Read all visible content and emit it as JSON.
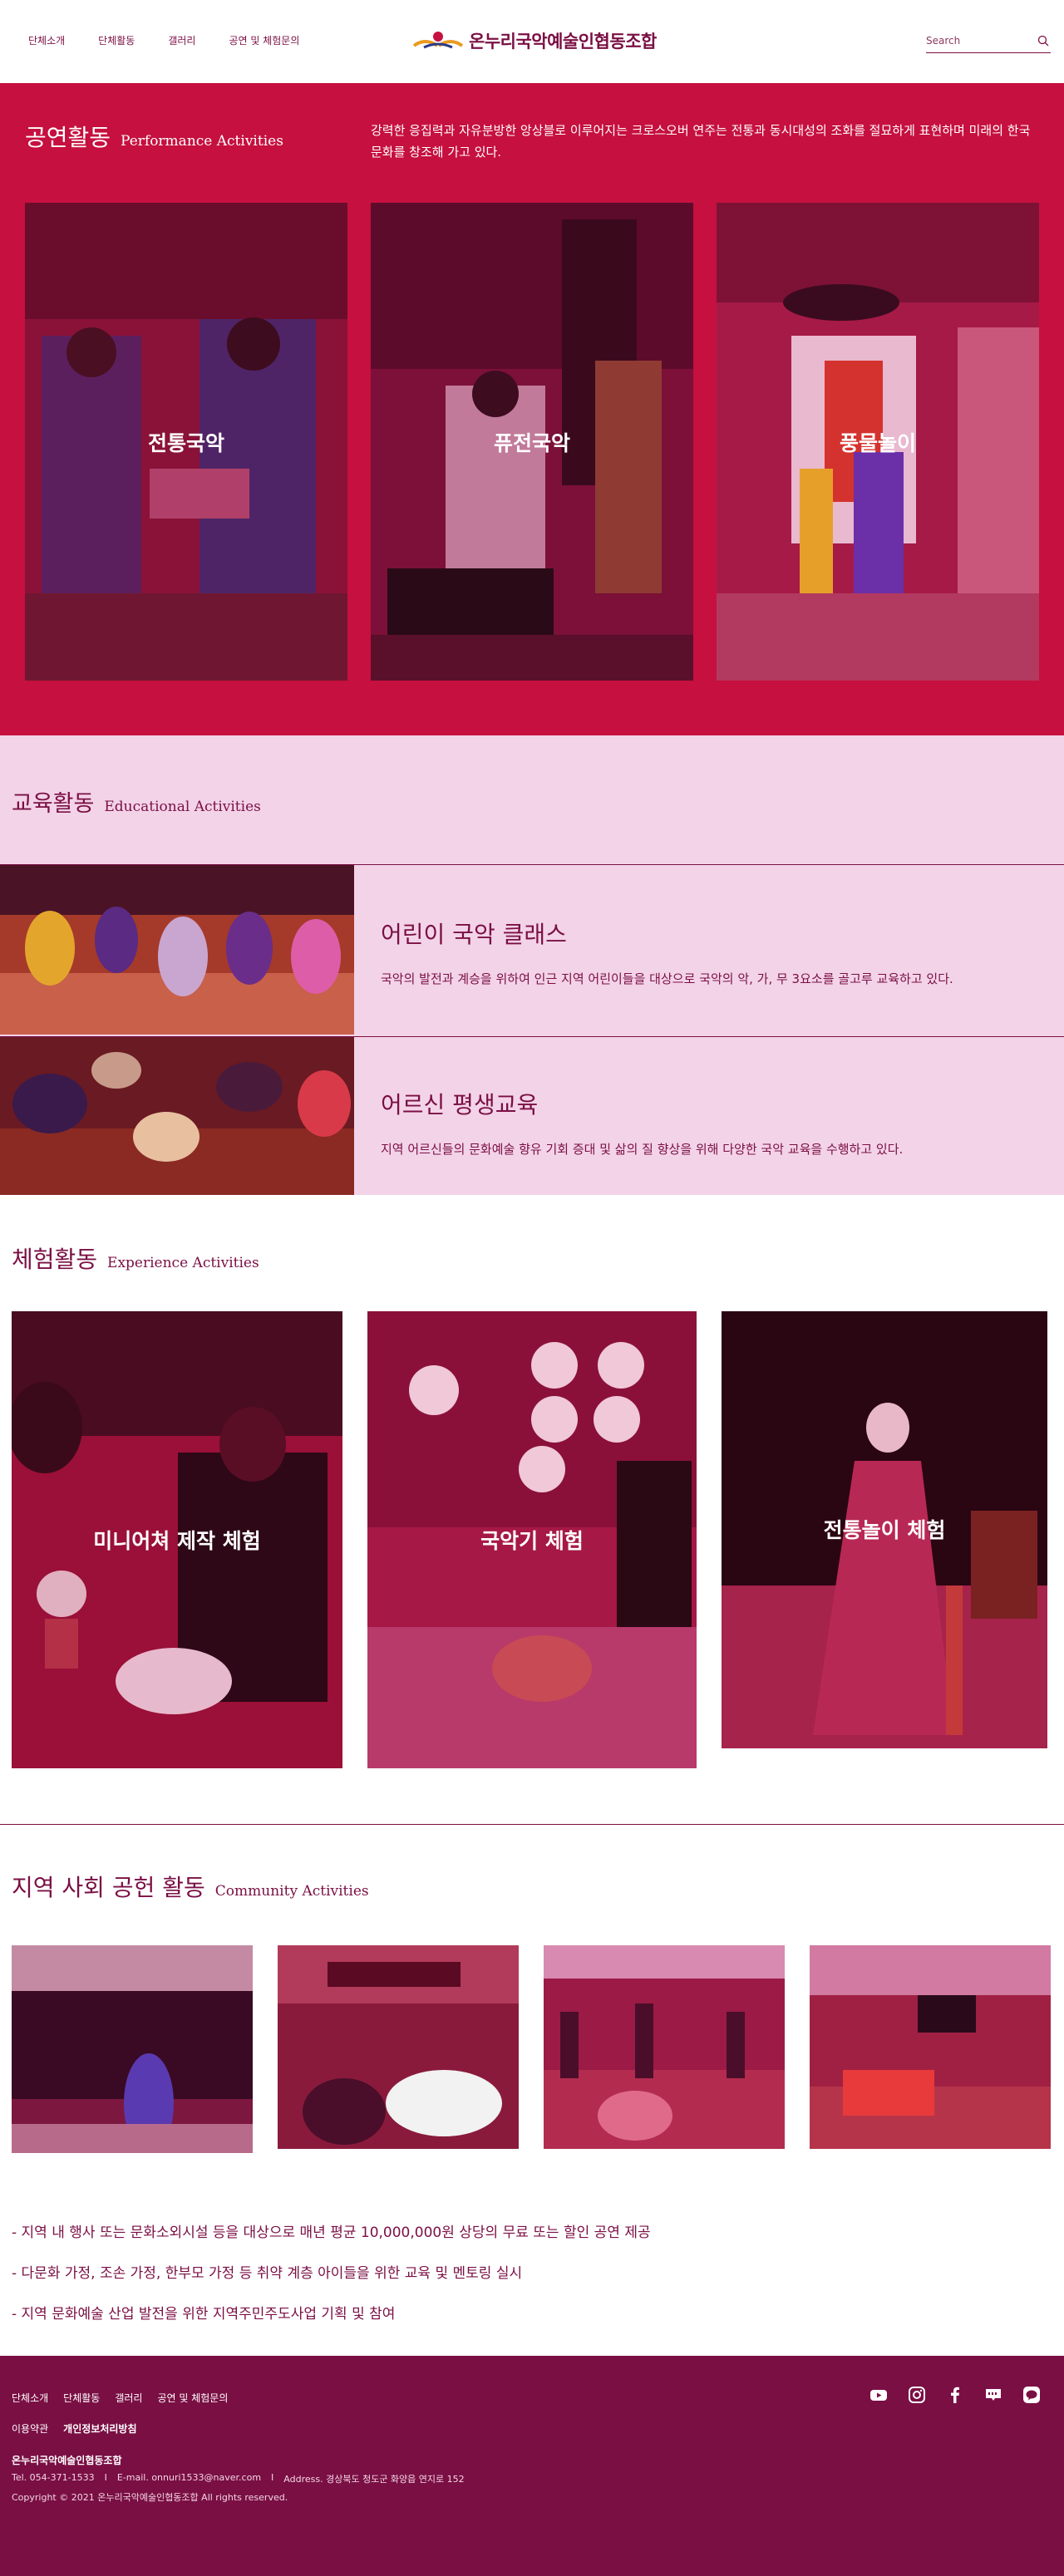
{
  "header": {
    "nav": [
      "단체소개",
      "단체활동",
      "갤러리",
      "공연 및 체험문의"
    ],
    "logo_text": "온누리국악예술인협동조합",
    "search_placeholder": "Search"
  },
  "performance": {
    "title_ko": "공연활동",
    "title_en": "Performance Activities",
    "description": "강력한 응집력과 자유분방한 앙상블로 이루어지는 크로스오버 연주는 전통과 동시대성의 조화를 절묘하게 표현하며 미래의 한국문화를 창조해 가고 있다.",
    "cards": [
      "전통국악",
      "퓨전국악",
      "풍물놀이"
    ]
  },
  "education": {
    "title_ko": "교육활동",
    "title_en": "Educational Activities",
    "rows": [
      {
        "title": "어린이 국악 클래스",
        "text": "국악의 발전과 계승을 위하여 인근 지역 어린이들을 대상으로 국악의 악, 가, 무 3요소를 골고루 교육하고 있다."
      },
      {
        "title": "어르신 평생교육",
        "text": "지역 어르신들의 문화예술 향유 기회 증대 및 삶의 질 향상을 위해 다양한 국악 교육을 수행하고 있다."
      }
    ]
  },
  "experience": {
    "title_ko": "체험활동",
    "title_en": "Experience Activities",
    "cards": [
      "미니어쳐 제작 체험",
      "국악기 체험",
      "전통놀이 체험"
    ]
  },
  "community": {
    "title_ko": "지역 사회 공헌 활동",
    "title_en": "Community Activities",
    "bullets": [
      "- 지역 내 행사 또는 문화소외시설 등을 대상으로 매년 평균 10,000,000원 상당의 무료 또는 할인 공연 제공",
      "- 다문화 가정, 조손 가정, 한부모 가정 등 취약 계층 아이들을 위한 교육 및 멘토링 실시",
      "- 지역 문화예술 산업 발전을 위한 지역주민주도사업 기획 및 참여"
    ]
  },
  "footer": {
    "nav": [
      "단체소개",
      "단체활동",
      "갤러리",
      "공연 및 체험문의"
    ],
    "terms": "이용약관",
    "privacy": "개인정보처리방침",
    "company": "온누리국악예술인협동조합",
    "tel": "Tel. 054-371-1533",
    "sep1": "I",
    "email": "E-mail. onnuri1533@naver.com",
    "sep2": "I",
    "address": "Address. 경상북도 청도군 화양읍 연지로 152",
    "copyright": "Copyright © 2021 온누리국악예술인협동조합 All rights reserved."
  },
  "colors": {
    "brand": "#7a0f44",
    "performance_bg": "#c6103f",
    "education_bg": "#f3d3e8",
    "footer_bg": "#7a0f44"
  },
  "icons": [
    "search-icon",
    "youtube-icon",
    "instagram-icon",
    "facebook-icon",
    "blog-icon",
    "kakao-icon"
  ]
}
